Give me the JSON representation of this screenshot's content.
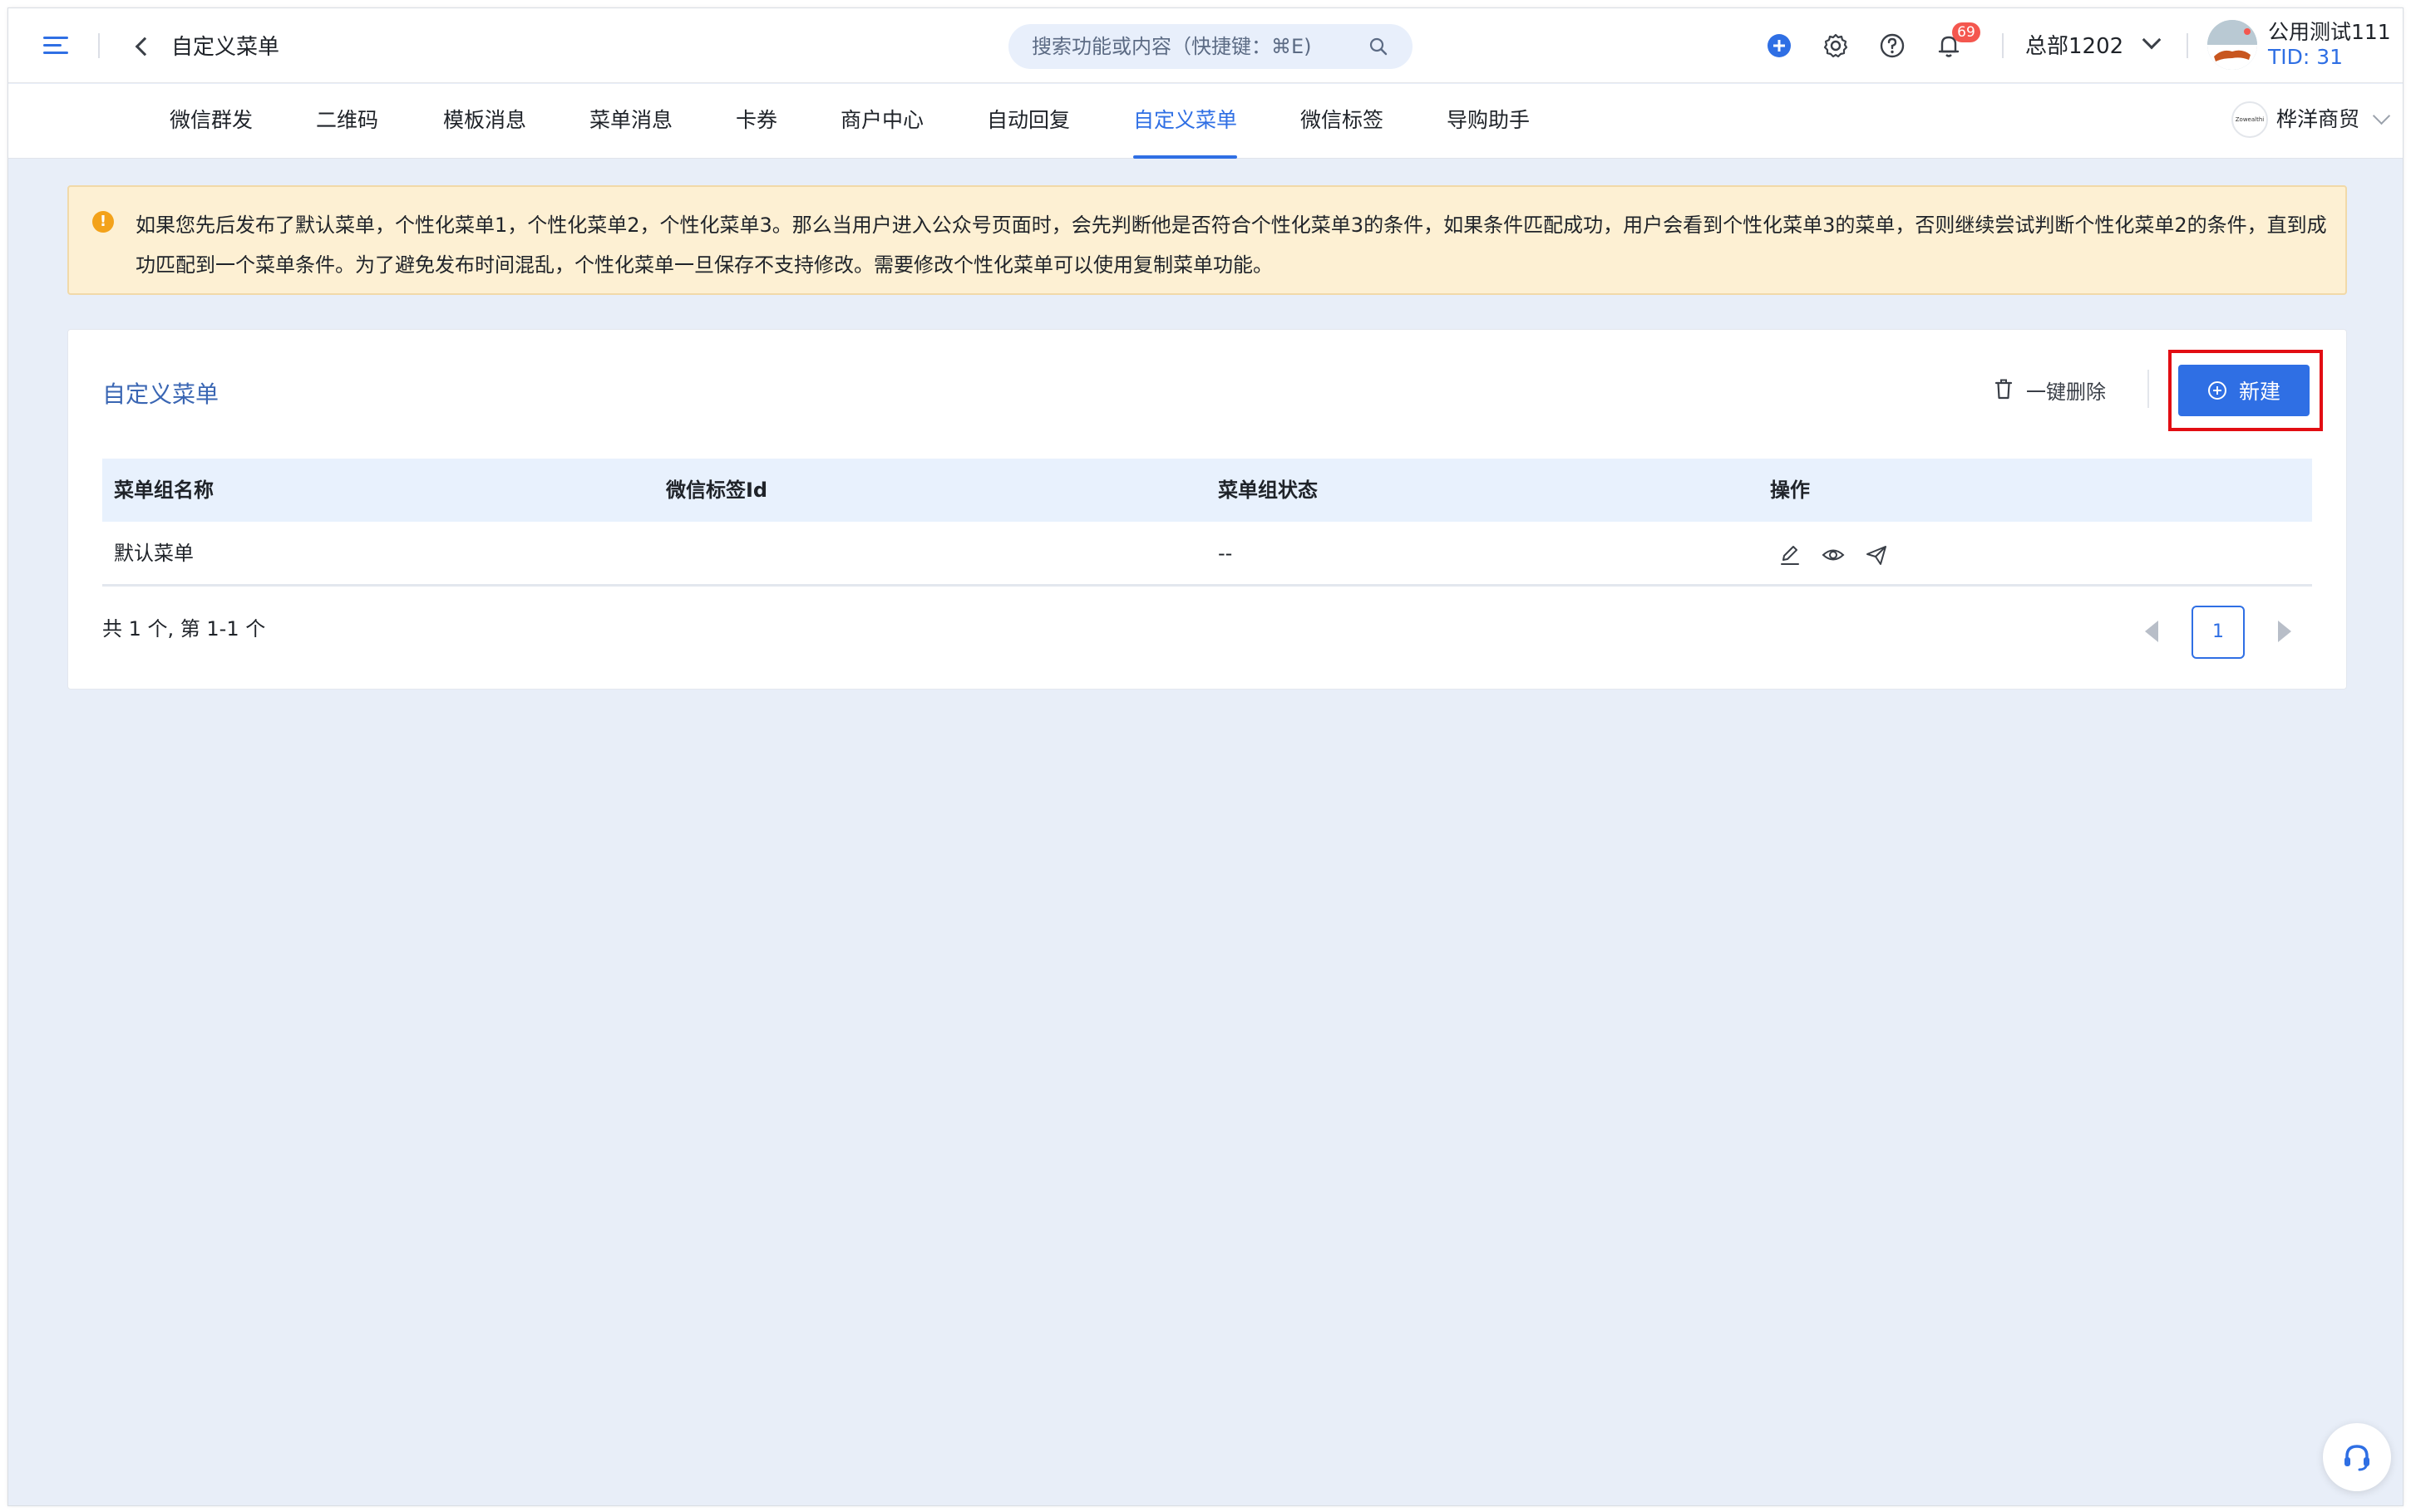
{
  "header": {
    "title": "自定义菜单",
    "search_placeholder": "搜索功能或内容（快捷键：⌘E)",
    "notification_count": "69",
    "org_name": "总部1202",
    "user_name": "公用测试111",
    "tid": "TID: 31"
  },
  "tabs": [
    {
      "label": "微信群发",
      "active": false
    },
    {
      "label": "二维码",
      "active": false
    },
    {
      "label": "模板消息",
      "active": false
    },
    {
      "label": "菜单消息",
      "active": false
    },
    {
      "label": "卡券",
      "active": false
    },
    {
      "label": "商户中心",
      "active": false
    },
    {
      "label": "自动回复",
      "active": false
    },
    {
      "label": "自定义菜单",
      "active": true
    },
    {
      "label": "微信标签",
      "active": false
    },
    {
      "label": "导购助手",
      "active": false
    }
  ],
  "shop": {
    "logo_text": "Zowealthi",
    "name": "桦洋商贸"
  },
  "alert": {
    "text": "如果您先后发布了默认菜单，个性化菜单1，个性化菜单2，个性化菜单3。那么当用户进入公众号页面时，会先判断他是否符合个性化菜单3的条件，如果条件匹配成功，用户会看到个性化菜单3的菜单，否则继续尝试判断个性化菜单2的条件，直到成功匹配到一个菜单条件。为了避免发布时间混乱，个性化菜单一旦保存不支持修改。需要修改个性化菜单可以使用复制菜单功能。"
  },
  "card": {
    "title": "自定义菜单",
    "delete_all_label": "一键删除",
    "new_label": "新建",
    "columns": [
      "菜单组名称",
      "微信标签Id",
      "菜单组状态",
      "操作"
    ],
    "rows": [
      {
        "name": "默认菜单",
        "tag_id": "",
        "status": "--"
      }
    ],
    "total_text": "共 1 个, 第 1-1 个",
    "current_page": "1"
  },
  "colors": {
    "accent": "#2f6fe4",
    "alert_bg": "#fdf0d3",
    "highlight": "#e20d13",
    "badge": "#f4574f"
  }
}
